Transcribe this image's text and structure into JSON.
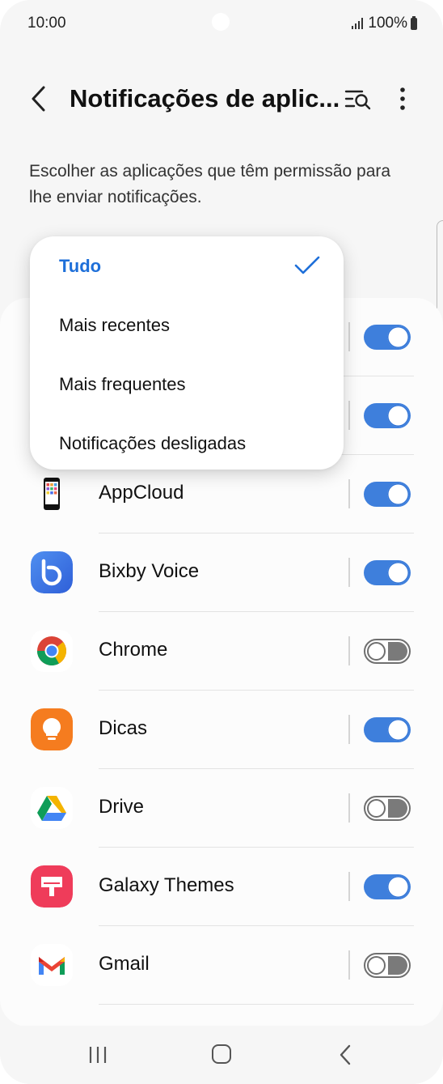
{
  "status_bar": {
    "time": "10:00",
    "battery": "100%"
  },
  "header": {
    "title": "Notificações de aplic..."
  },
  "description": "Escolher as aplicações que têm permissão para lhe enviar notificações.",
  "filter_menu": {
    "options": [
      "Tudo",
      "Mais recentes",
      "Mais frequentes",
      "Notificações desligadas"
    ],
    "selected": "Tudo"
  },
  "apps": [
    {
      "name": "AppCloud",
      "enabled": true,
      "icon": "appcloud-icon"
    },
    {
      "name": "Bixby Voice",
      "enabled": true,
      "icon": "bixby-voice-icon"
    },
    {
      "name": "Chrome",
      "enabled": false,
      "icon": "chrome-icon"
    },
    {
      "name": "Dicas",
      "enabled": true,
      "icon": "dicas-lightbulb-icon"
    },
    {
      "name": "Drive",
      "enabled": false,
      "icon": "google-drive-icon"
    },
    {
      "name": "Galaxy Themes",
      "enabled": true,
      "icon": "galaxy-themes-icon"
    },
    {
      "name": "Gmail",
      "enabled": false,
      "icon": "gmail-icon"
    }
  ],
  "colors": {
    "accent": "#3e7fdc",
    "selected_text": "#1e6fd9",
    "toggle_off": "#6f6f6f"
  }
}
